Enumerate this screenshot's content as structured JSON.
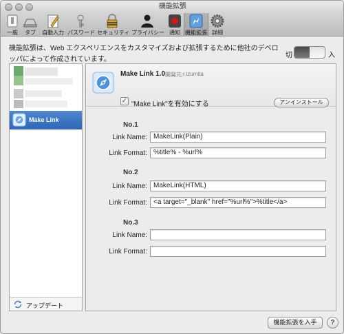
{
  "window": {
    "title": "機能拡張"
  },
  "toolbar": {
    "items": [
      {
        "label": "一般",
        "icon": "general-switch-icon"
      },
      {
        "label": "タブ",
        "icon": "tabs-icon"
      },
      {
        "label": "自動入力",
        "icon": "autofill-pencil-icon"
      },
      {
        "label": "パスワード",
        "icon": "key-icon"
      },
      {
        "label": "セキュリティ",
        "icon": "lock-icon"
      },
      {
        "label": "プライバシー",
        "icon": "person-silhouette-icon"
      },
      {
        "label": "通知",
        "icon": "notification-icon"
      },
      {
        "label": "機能拡張",
        "icon": "extensions-icon"
      },
      {
        "label": "詳細",
        "icon": "gear-icon"
      }
    ],
    "active": "機能拡張"
  },
  "description": "機能拡張は、Web エクスペリエンスをカスタマイズおよび拡張するために他社のデベロッパによって作成されています。",
  "master_toggle": {
    "off_label": "切",
    "on_label": "入",
    "state": "on"
  },
  "sidebar": {
    "items": [
      {
        "label": "Make Link",
        "selected": true,
        "icon": "compass-icon"
      }
    ],
    "footer_label": "アップデート"
  },
  "extension": {
    "name": "Make Link 1.0",
    "developer_label": "開発元:",
    "developer": "r.izumita",
    "enable_label": "\"Make Link\"を有効にする",
    "enabled": true,
    "uninstall_label": "アンインストール",
    "sections": [
      {
        "title": "No.1",
        "name_label": "Link Name:",
        "name_value": "MakeLink(Plain)",
        "format_label": "Link Format:",
        "format_value": "%title% - %url%"
      },
      {
        "title": "No.2",
        "name_label": "Link Name:",
        "name_value": "MakeLink(HTML)",
        "format_label": "Link Format:",
        "format_value": "<a target=\"_blank\" href=\"%url%\">%title</a>"
      },
      {
        "title": "No.3",
        "name_label": "Link Name:",
        "name_value": "",
        "format_label": "Link Format:",
        "format_value": ""
      }
    ]
  },
  "footer": {
    "get_extensions_label": "機能拡張を入手",
    "help_label": "?"
  },
  "colors": {
    "selection": "#3a70c0",
    "window_bg": "#ececec",
    "record_red": "#d01a1a",
    "check_blue": "#2c5fb3"
  }
}
